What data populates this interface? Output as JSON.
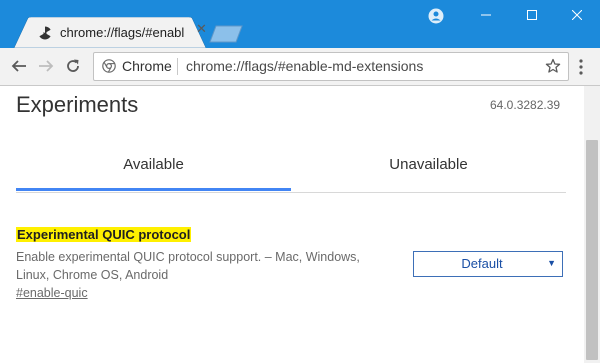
{
  "browser": {
    "tab_title": "chrome://flags/#enable-m",
    "site_chip": "Chrome",
    "url": "chrome://flags/#enable-md-extensions",
    "colors": {
      "titlebar": "#1c8adb",
      "accent": "#4285f4",
      "highlight": "#fff000"
    },
    "icons": [
      "radiation-icon",
      "close-icon",
      "profile-icon",
      "minimize-icon",
      "maximize-icon",
      "window-close-icon",
      "back-arrow-icon",
      "forward-arrow-icon",
      "reload-icon",
      "chrome-logo-icon",
      "bookmark-star-icon",
      "kebab-menu-icon"
    ]
  },
  "page": {
    "heading": "Experiments",
    "version": "64.0.3282.39",
    "tabs": [
      {
        "label": "Available",
        "selected": true
      },
      {
        "label": "Unavailable",
        "selected": false
      }
    ],
    "experiment": {
      "title": "Experimental QUIC protocol",
      "description": "Enable experimental QUIC protocol support. – Mac, Windows, Linux, Chrome OS, Android",
      "link": "#enable-quic",
      "select_value": "Default"
    }
  }
}
